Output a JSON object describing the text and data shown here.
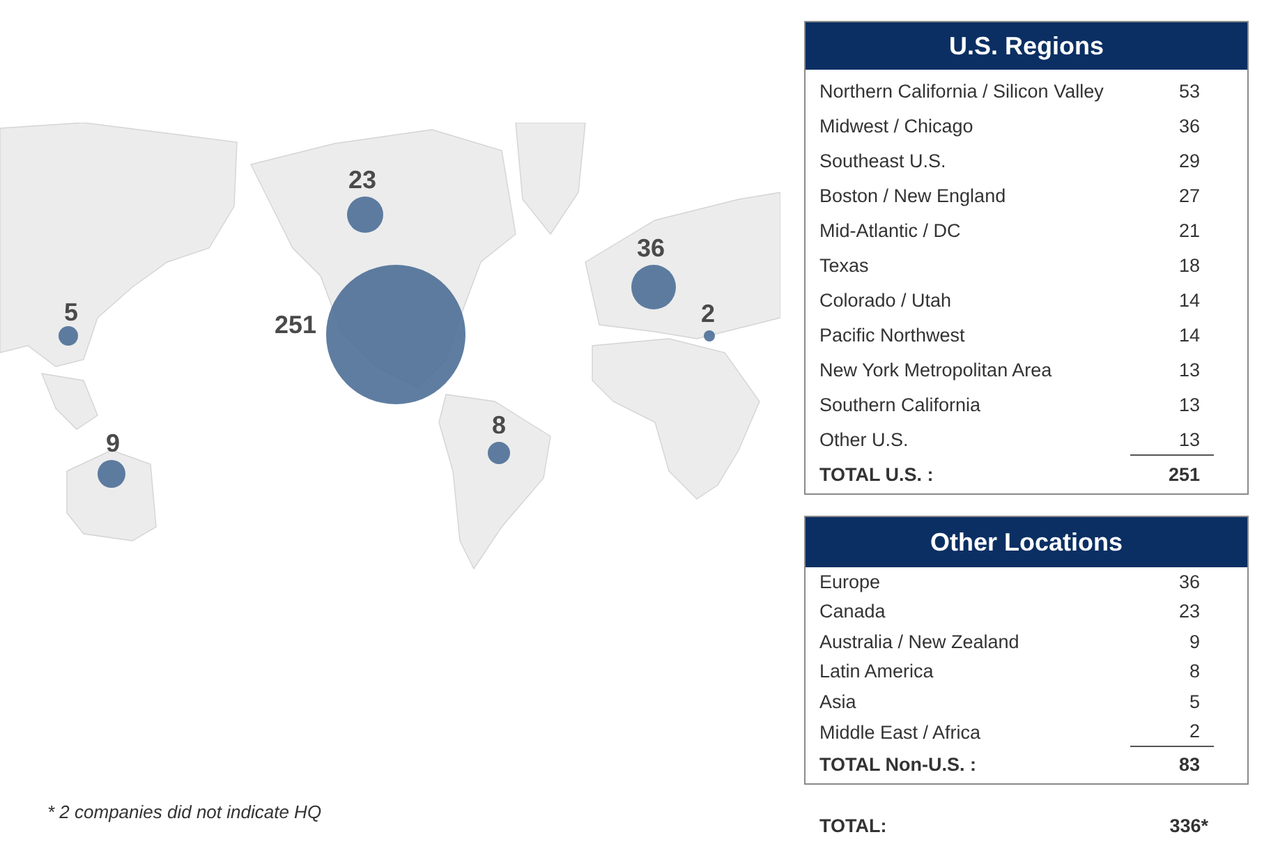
{
  "map": {
    "bubbles": [
      {
        "label": "5"
      },
      {
        "label": "9"
      },
      {
        "label": "23"
      },
      {
        "label": "251"
      },
      {
        "label": "8"
      },
      {
        "label": "36"
      },
      {
        "label": "2"
      }
    ]
  },
  "footnote": "* 2 companies did not indicate HQ",
  "tables": [
    {
      "title": "U.S. Regions",
      "rows": [
        {
          "name": "Northern California / Silicon Valley",
          "value": "53"
        },
        {
          "name": "Midwest / Chicago",
          "value": "36"
        },
        {
          "name": "Southeast U.S.",
          "value": "29"
        },
        {
          "name": "Boston / New England",
          "value": "27"
        },
        {
          "name": "Mid-Atlantic / DC",
          "value": "21"
        },
        {
          "name": "Texas",
          "value": "18"
        },
        {
          "name": "Colorado / Utah",
          "value": "14"
        },
        {
          "name": "Pacific Northwest",
          "value": "14"
        },
        {
          "name": "New York Metropolitan Area",
          "value": "13"
        },
        {
          "name": "Southern California",
          "value": "13"
        },
        {
          "name": "Other U.S.",
          "value": "13"
        }
      ],
      "total": {
        "name": "TOTAL U.S. :",
        "value": "251"
      }
    },
    {
      "title": "Other Locations",
      "rows": [
        {
          "name": "Europe",
          "value": "36"
        },
        {
          "name": "Canada",
          "value": "23"
        },
        {
          "name": "Australia / New Zealand",
          "value": "9"
        },
        {
          "name": "Latin America",
          "value": "8"
        },
        {
          "name": "Asia",
          "value": "5"
        },
        {
          "name": "Middle East / Africa",
          "value": "2"
        }
      ],
      "total": {
        "name": "TOTAL Non-U.S. :",
        "value": "83"
      }
    }
  ],
  "grand_total": {
    "name": "TOTAL:",
    "value": "336*"
  }
}
